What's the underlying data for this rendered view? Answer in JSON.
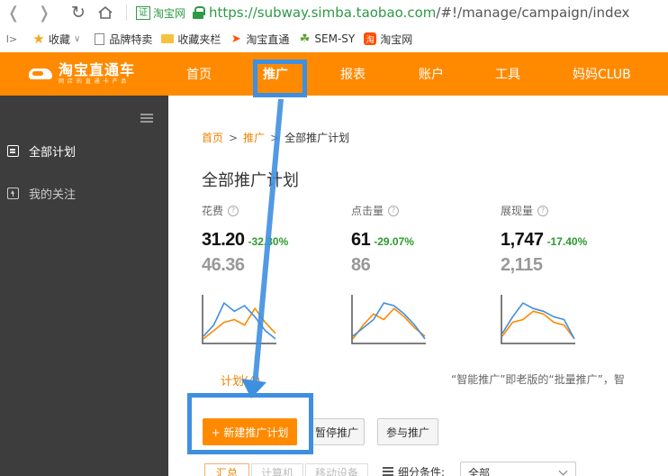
{
  "browser": {
    "cert_label": "证",
    "site_name": "淘宝网",
    "url_protocol": "https://",
    "url_host": "subway.simba.taobao.com",
    "url_path": "/#!/manage/campaign/index"
  },
  "bookmarks": [
    {
      "label": "收藏",
      "icon": "star-icon"
    },
    {
      "label": "品牌特卖",
      "icon": "document-icon"
    },
    {
      "label": "收藏夹栏",
      "icon": "folder-icon"
    },
    {
      "label": "淘宝直通",
      "icon": "taobao-zhitong-icon"
    },
    {
      "label": "SEM-SY",
      "icon": "sem-icon"
    },
    {
      "label": "淘宝网",
      "icon": "taobao-icon"
    }
  ],
  "topbar": {
    "logo_main": "淘宝直通车",
    "logo_sub": "网 店 的 直 通 卡 产 品",
    "nav": [
      {
        "label": "首页",
        "key": "home"
      },
      {
        "label": "推广",
        "key": "promote",
        "active": true
      },
      {
        "label": "报表",
        "key": "report"
      },
      {
        "label": "账户",
        "key": "account"
      },
      {
        "label": "工具",
        "key": "tools"
      },
      {
        "label": "妈妈CLUB",
        "key": "club"
      }
    ],
    "color": "#ff8a00"
  },
  "sidebar": {
    "items": [
      {
        "label": "全部计划",
        "active": true
      },
      {
        "label": "我的关注",
        "active": false
      }
    ]
  },
  "breadcrumb": {
    "home": "首页",
    "sep": ">",
    "promote": "推广",
    "current": "全部推广计划"
  },
  "page_title": "全部推广计划",
  "metrics": [
    {
      "label": "花费",
      "value": "31.20",
      "change": "-32.30%",
      "previous": "46.36"
    },
    {
      "label": "点击量",
      "value": "61",
      "change": "-29.07%",
      "previous": "86"
    },
    {
      "label": "展现量",
      "value": "1,747",
      "change": "-17.40%",
      "previous": "2,115"
    }
  ],
  "sparklines": [
    {
      "blue": [
        2,
        6,
        14,
        11,
        13,
        9,
        4,
        1
      ],
      "orange": [
        1,
        4,
        7,
        8,
        6,
        12,
        7,
        3
      ]
    },
    {
      "blue": [
        2,
        5,
        8,
        14,
        13,
        10,
        6,
        1
      ],
      "orange": [
        1,
        6,
        10,
        8,
        12,
        9,
        5,
        2
      ]
    },
    {
      "blue": [
        3,
        9,
        14,
        12,
        11,
        9,
        8,
        1
      ],
      "orange": [
        2,
        7,
        8,
        11,
        10,
        7,
        6,
        1
      ]
    }
  ],
  "colors": {
    "blue": "#3f8fe0",
    "orange": "#ff8a00",
    "green": "#2e9a2e"
  },
  "tabs": {
    "plan_tab": "计划(4)"
  },
  "notice": "“智能推广”即老版的“批量推广”，智",
  "buttons": {
    "new_plan": "+ 新建推广计划",
    "pause": "暂停推广",
    "join": "参与推广"
  },
  "segments": [
    "汇总",
    "计算机",
    "移动设备"
  ],
  "filter": {
    "label": "细分条件:",
    "value": "全部"
  }
}
